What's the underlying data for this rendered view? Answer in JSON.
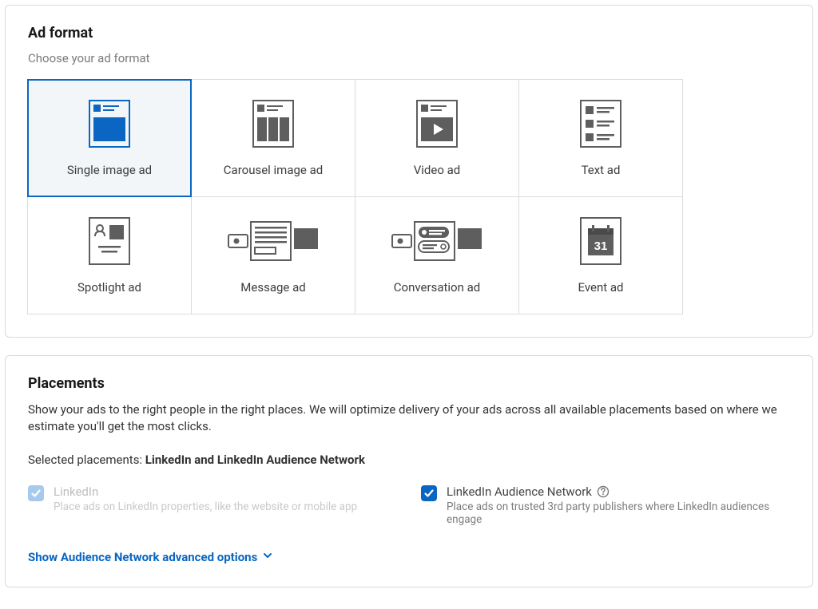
{
  "adFormat": {
    "title": "Ad format",
    "subtitle": "Choose your ad format",
    "tiles": [
      {
        "label": "Single image ad",
        "selected": true
      },
      {
        "label": "Carousel image ad",
        "selected": false
      },
      {
        "label": "Video ad",
        "selected": false
      },
      {
        "label": "Text ad",
        "selected": false
      },
      {
        "label": "Spotlight ad",
        "selected": false
      },
      {
        "label": "Message ad",
        "selected": false
      },
      {
        "label": "Conversation ad",
        "selected": false
      },
      {
        "label": "Event ad",
        "selected": false
      }
    ]
  },
  "placements": {
    "title": "Placements",
    "description": "Show your ads to the right people in the right places. We will optimize delivery of your ads across all available placements based on where we estimate you'll get the most clicks.",
    "selectedLabel": "Selected placements: ",
    "selectedValue": "LinkedIn and LinkedIn Audience Network",
    "items": [
      {
        "name": "LinkedIn",
        "desc": "Place ads on LinkedIn properties, like the website or mobile app",
        "checked": true,
        "disabled": true
      },
      {
        "name": "LinkedIn Audience Network",
        "desc": "Place ads on trusted 3rd party publishers where LinkedIn audiences engage",
        "checked": true,
        "disabled": false
      }
    ],
    "advancedToggle": "Show Audience Network advanced options"
  }
}
